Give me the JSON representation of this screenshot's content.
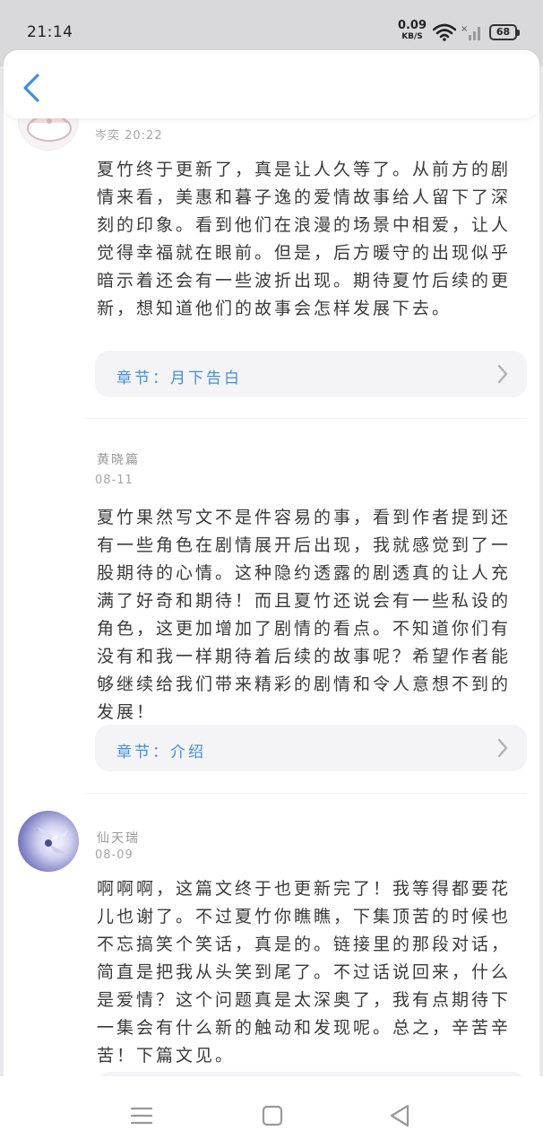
{
  "status_bar": {
    "time": "21:14",
    "net_speed": "0.09",
    "net_unit": "KB/S",
    "battery": "68",
    "icons": [
      "wifi-icon",
      "signal-icon",
      "battery-icon"
    ]
  },
  "header": {
    "back_icon": "chevron-left-icon"
  },
  "comments": [
    {
      "nickname": "",
      "date": "岑奕 20:22",
      "text": "夏竹终于更新了，真是让人久等了。从前方的剧情来看，美惠和暮子逸的爱情故事给人留下了深刻的印象。看到他们在浪漫的场景中相爱，让人觉得幸福就在眼前。但是，后方暖守的出现似乎暗示着还会有一些波折出现。期待夏竹后续的更新，想知道他们的故事会怎样发展下去。",
      "chapter": "章节：月下告白"
    },
    {
      "nickname": "黄晓篇",
      "date": "08-11",
      "text": "夏竹果然写文不是件容易的事，看到作者提到还有一些角色在剧情展开后出现，我就感觉到了一股期待的心情。这种隐约透露的剧透真的让人充满了好奇和期待！而且夏竹还说会有一些私设的角色，这更加增加了剧情的看点。不知道你们有没有和我一样期待着后续的故事呢？希望作者能够继续给我们带来精彩的剧情和令人意想不到的发展！",
      "chapter": "章节：介绍"
    },
    {
      "nickname": "仙天瑞",
      "date": "08-09",
      "text": "啊啊啊，这篇文终于也更新完了！我等得都要花儿也谢了。不过夏竹你瞧瞧，下集顶苦的时候也不忘搞笑个笑话，真是的。链接里的那段对话，简直是把我从头笑到尾了。不过话说回来，什么是爱情？这个问题真是太深奥了，我有点期待下一集会有什么新的触动和发现呢。总之，辛苦辛苦！下篇文见。",
      "chapter": ""
    }
  ],
  "nav": {
    "icons": [
      "menu-icon",
      "home-icon",
      "back-triangle-icon"
    ]
  },
  "colors": {
    "accent": "#3f8fd9",
    "status_bar_bg": "#d9d9dc"
  }
}
